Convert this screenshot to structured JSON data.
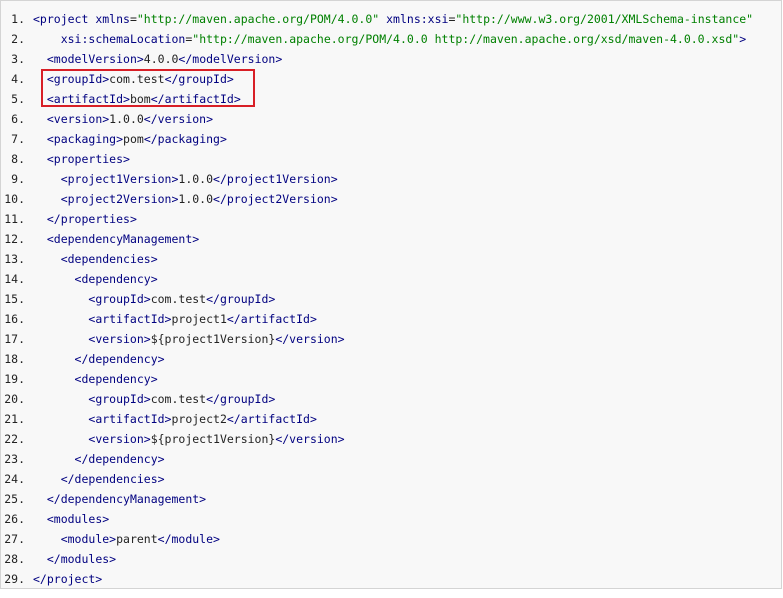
{
  "code": {
    "lines": [
      {
        "number": "1.",
        "indent": "",
        "parts": [
          {
            "text": "<project",
            "kind": "tag"
          },
          {
            "text": " xmlns",
            "kind": "attr"
          },
          {
            "text": "=",
            "kind": "text"
          },
          {
            "text": "\"http://maven.apache.org/POM/4.0.0\"",
            "kind": "value"
          },
          {
            "text": " xmlns:xsi",
            "kind": "attr"
          },
          {
            "text": "=",
            "kind": "text"
          },
          {
            "text": "\"http://www.w3.org/2001/XMLSchema-instance\"",
            "kind": "value"
          }
        ]
      },
      {
        "number": "2.",
        "indent": "    ",
        "parts": [
          {
            "text": "xsi:schemaLocation",
            "kind": "attr"
          },
          {
            "text": "=",
            "kind": "text"
          },
          {
            "text": "\"http://maven.apache.org/POM/4.0.0 http://maven.apache.org/xsd/maven-4.0.0.xsd\"",
            "kind": "value"
          },
          {
            "text": ">",
            "kind": "tag"
          }
        ]
      },
      {
        "number": "3.",
        "indent": "  ",
        "parts": [
          {
            "text": "<modelVersion>",
            "kind": "tag"
          },
          {
            "text": "4.0.0",
            "kind": "text"
          },
          {
            "text": "</modelVersion>",
            "kind": "tag"
          }
        ]
      },
      {
        "number": "4.",
        "indent": "  ",
        "parts": [
          {
            "text": "<groupId>",
            "kind": "tag"
          },
          {
            "text": "com.test",
            "kind": "text"
          },
          {
            "text": "</groupId>",
            "kind": "tag"
          }
        ]
      },
      {
        "number": "5.",
        "indent": "  ",
        "parts": [
          {
            "text": "<artifactId>",
            "kind": "tag"
          },
          {
            "text": "bom",
            "kind": "text"
          },
          {
            "text": "</artifactId>",
            "kind": "tag"
          }
        ]
      },
      {
        "number": "6.",
        "indent": "  ",
        "parts": [
          {
            "text": "<version>",
            "kind": "tag"
          },
          {
            "text": "1.0.0",
            "kind": "text"
          },
          {
            "text": "</version>",
            "kind": "tag"
          }
        ]
      },
      {
        "number": "7.",
        "indent": "  ",
        "parts": [
          {
            "text": "<packaging>",
            "kind": "tag"
          },
          {
            "text": "pom",
            "kind": "text"
          },
          {
            "text": "</packaging>",
            "kind": "tag"
          }
        ]
      },
      {
        "number": "8.",
        "indent": "  ",
        "parts": [
          {
            "text": "<properties>",
            "kind": "tag"
          }
        ]
      },
      {
        "number": "9.",
        "indent": "    ",
        "parts": [
          {
            "text": "<project1Version>",
            "kind": "tag"
          },
          {
            "text": "1.0.0",
            "kind": "text"
          },
          {
            "text": "</project1Version>",
            "kind": "tag"
          }
        ]
      },
      {
        "number": "10.",
        "indent": "    ",
        "parts": [
          {
            "text": "<project2Version>",
            "kind": "tag"
          },
          {
            "text": "1.0.0",
            "kind": "text"
          },
          {
            "text": "</project2Version>",
            "kind": "tag"
          }
        ]
      },
      {
        "number": "11.",
        "indent": "  ",
        "parts": [
          {
            "text": "</properties>",
            "kind": "tag"
          }
        ]
      },
      {
        "number": "12.",
        "indent": "  ",
        "parts": [
          {
            "text": "<dependencyManagement>",
            "kind": "tag"
          }
        ]
      },
      {
        "number": "13.",
        "indent": "    ",
        "parts": [
          {
            "text": "<dependencies>",
            "kind": "tag"
          }
        ]
      },
      {
        "number": "14.",
        "indent": "      ",
        "parts": [
          {
            "text": "<dependency>",
            "kind": "tag"
          }
        ]
      },
      {
        "number": "15.",
        "indent": "        ",
        "parts": [
          {
            "text": "<groupId>",
            "kind": "tag"
          },
          {
            "text": "com.test",
            "kind": "text"
          },
          {
            "text": "</groupId>",
            "kind": "tag"
          }
        ]
      },
      {
        "number": "16.",
        "indent": "        ",
        "parts": [
          {
            "text": "<artifactId>",
            "kind": "tag"
          },
          {
            "text": "project1",
            "kind": "text"
          },
          {
            "text": "</artifactId>",
            "kind": "tag"
          }
        ]
      },
      {
        "number": "17.",
        "indent": "        ",
        "parts": [
          {
            "text": "<version>",
            "kind": "tag"
          },
          {
            "text": "${project1Version}",
            "kind": "text"
          },
          {
            "text": "</version>",
            "kind": "tag"
          }
        ]
      },
      {
        "number": "18.",
        "indent": "      ",
        "parts": [
          {
            "text": "</dependency>",
            "kind": "tag"
          }
        ]
      },
      {
        "number": "19.",
        "indent": "      ",
        "parts": [
          {
            "text": "<dependency>",
            "kind": "tag"
          }
        ]
      },
      {
        "number": "20.",
        "indent": "        ",
        "parts": [
          {
            "text": "<groupId>",
            "kind": "tag"
          },
          {
            "text": "com.test",
            "kind": "text"
          },
          {
            "text": "</groupId>",
            "kind": "tag"
          }
        ]
      },
      {
        "number": "21.",
        "indent": "        ",
        "parts": [
          {
            "text": "<artifactId>",
            "kind": "tag"
          },
          {
            "text": "project2",
            "kind": "text"
          },
          {
            "text": "</artifactId>",
            "kind": "tag"
          }
        ]
      },
      {
        "number": "22.",
        "indent": "        ",
        "parts": [
          {
            "text": "<version>",
            "kind": "tag"
          },
          {
            "text": "${project1Version}",
            "kind": "text"
          },
          {
            "text": "</version>",
            "kind": "tag"
          }
        ]
      },
      {
        "number": "23.",
        "indent": "      ",
        "parts": [
          {
            "text": "</dependency>",
            "kind": "tag"
          }
        ]
      },
      {
        "number": "24.",
        "indent": "    ",
        "parts": [
          {
            "text": "</dependencies>",
            "kind": "tag"
          }
        ]
      },
      {
        "number": "25.",
        "indent": "  ",
        "parts": [
          {
            "text": "</dependencyManagement>",
            "kind": "tag"
          }
        ]
      },
      {
        "number": "26.",
        "indent": "  ",
        "parts": [
          {
            "text": "<modules>",
            "kind": "tag"
          }
        ]
      },
      {
        "number": "27.",
        "indent": "    ",
        "parts": [
          {
            "text": "<module>",
            "kind": "tag"
          },
          {
            "text": "parent",
            "kind": "text"
          },
          {
            "text": "</module>",
            "kind": "tag"
          }
        ]
      },
      {
        "number": "28.",
        "indent": "  ",
        "parts": [
          {
            "text": "</modules>",
            "kind": "tag"
          }
        ]
      },
      {
        "number": "29.",
        "indent": "",
        "parts": [
          {
            "text": "</project>",
            "kind": "tag"
          }
        ]
      }
    ]
  },
  "colors": {
    "tag": "#000080",
    "attribute": "#000080",
    "value": "#008000",
    "highlight": "#d81f26"
  }
}
